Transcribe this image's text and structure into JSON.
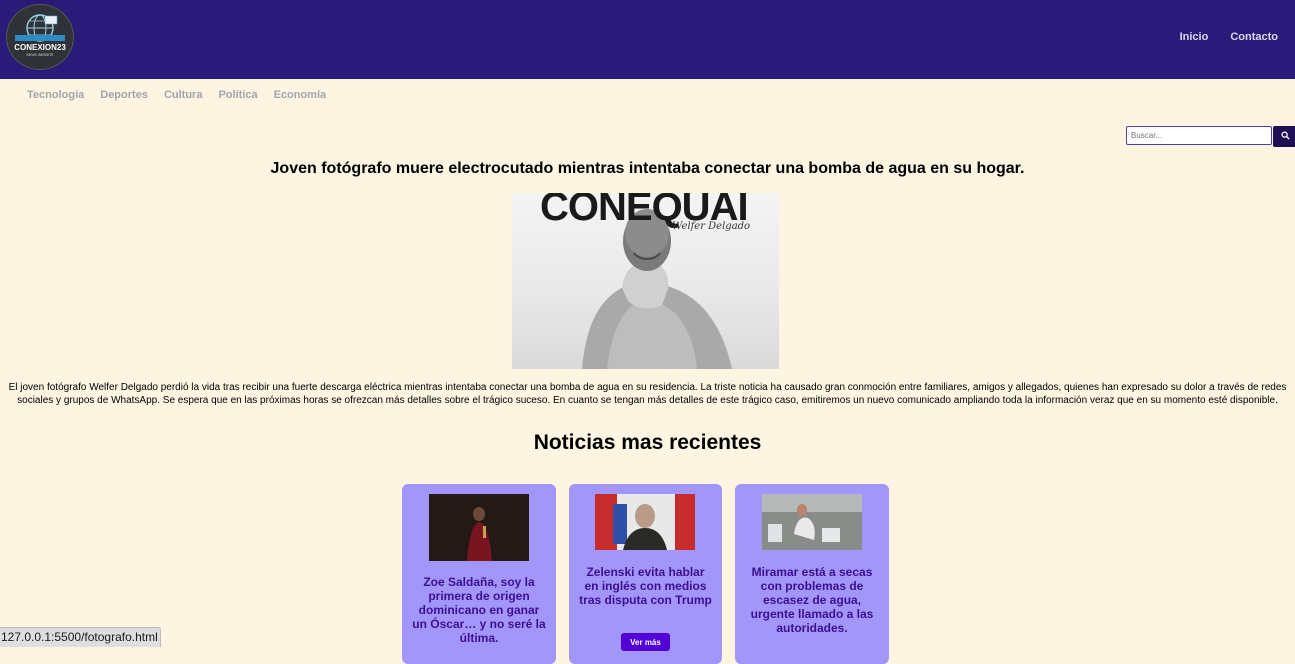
{
  "brand": {
    "logo_text": "CONEXION23",
    "logo_sub": "NEWS WEBSITE"
  },
  "header": {
    "nav": [
      "Inicio",
      "Contacto"
    ]
  },
  "categories": [
    "Tecnología",
    "Deportes",
    "Cultura",
    "Política",
    "Economía"
  ],
  "search": {
    "placeholder": "Buscar...",
    "button_icon": "search-icon"
  },
  "article": {
    "title": "Joven fotógrafo muere electrocutado mientras intentaba conectar una bomba de agua en su hogar.",
    "image_heading": "CONEQUAI",
    "image_signature": "Welfer Delgado",
    "body": "El joven fotógrafo Welfer Delgado perdió la vida tras recibir una fuerte descarga eléctrica mientras intentaba conectar una bomba de agua en su residencia. La triste noticia ha causado gran conmoción entre familiares, amigos y allegados, quienes han expresado su dolor a través de redes sociales y grupos de WhatsApp. Se espera que en las próximas horas se ofrezcan más detalles sobre el trágico suceso. En cuanto se tengan más detalles de este trágico caso, emitiremos un nuevo comunicado ampliando toda la información veraz que en su momento esté disponible."
  },
  "recent": {
    "title": "Noticias mas recientes",
    "cards": [
      {
        "text": "Zoe Saldaña, soy la primera de origen dominicano en ganar un Óscar… y no seré la última."
      },
      {
        "text": "Zelenski evita hablar en inglés con medios tras disputa con Trump",
        "button": "Ver más"
      },
      {
        "text": "Miramar está a secas con problemas de escasez de agua, urgente llamado a las autoridades."
      }
    ]
  },
  "status_bar": {
    "url": "127.0.0.1:5500/fotografo.html"
  },
  "colors": {
    "header_bg": "#2a1a7a",
    "page_bg": "#fdf5e1",
    "card_bg": "#a396fb",
    "card_text": "#3d0f8e",
    "button_bg": "#5200d6"
  }
}
